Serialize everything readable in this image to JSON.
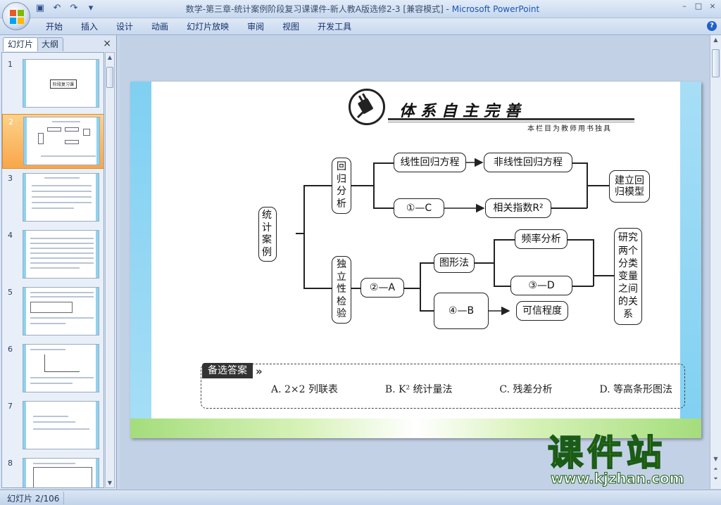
{
  "window": {
    "title_doc": "数学-第三章-统计案例阶段复习课课件-新人教A版选修2-3 [兼容模式] - ",
    "title_app": "Microsoft PowerPoint",
    "min": "–",
    "max": "□",
    "close": "×"
  },
  "ribbon": {
    "tabs": [
      "开始",
      "插入",
      "设计",
      "动画",
      "幻灯片放映",
      "审阅",
      "视图",
      "开发工具"
    ],
    "help": "?"
  },
  "pane": {
    "tab_slides": "幻灯片",
    "tab_outline": "大纲",
    "close": "×",
    "thumbs": [
      {
        "num": "1"
      },
      {
        "num": "2"
      },
      {
        "num": "3"
      },
      {
        "num": "4"
      },
      {
        "num": "5"
      },
      {
        "num": "6"
      },
      {
        "num": "7"
      },
      {
        "num": "8"
      }
    ],
    "thumb1_text": "阶段复习课",
    "selected_index": 2
  },
  "slide": {
    "header_title": "体系自主完善",
    "header_sub": "本栏目为教师用书独具",
    "root": "统计案例",
    "branch1": "回归分析",
    "branch2": "独立性检验",
    "n_linear": "线性回归方程",
    "n_nonlinear": "非线性回归方程",
    "n_c": "①—C",
    "n_r2": "相关指数R²",
    "n_build1": "建立回",
    "n_build2": "归模型",
    "n_a": "②—A",
    "n_graph": "图形法",
    "n_freq": "频率分析",
    "n_d": "③—D",
    "n_b": "④—B",
    "n_credible": "可信程度",
    "n_study": "研究两个分类变量之间的关系",
    "answers_label": "备选答案",
    "answers_tip": "»",
    "answers": [
      "A. 2×2 列联表",
      "B. K² 统计量法",
      "C. 残差分析",
      "D. 等高条形图法"
    ]
  },
  "watermark": {
    "line1": "课件站",
    "line2": "www.kjzhan.com"
  },
  "status": {
    "slide_info": "幻灯片 2/106"
  }
}
